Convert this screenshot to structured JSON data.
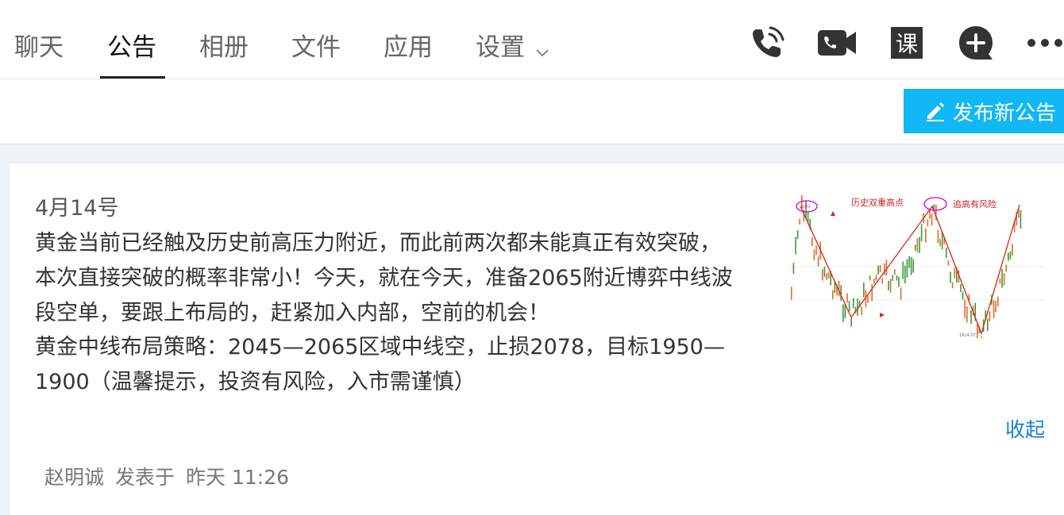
{
  "tabs": [
    {
      "label": "聊天"
    },
    {
      "label": "公告"
    },
    {
      "label": "相册"
    },
    {
      "label": "文件"
    },
    {
      "label": "应用"
    },
    {
      "label": "设置"
    }
  ],
  "active_tab": "公告",
  "toolbar": {
    "publish_label": "发布新公告",
    "icons": [
      "phone-icon",
      "video-call-icon",
      "class-icon",
      "add-icon",
      "more-icon"
    ]
  },
  "announcement": {
    "date": "4月14号",
    "body_lines": [
      "黄金当前已经触及历史前高压力附近，而此前两次都未能真正有效突破，",
      "本次直接突破的概率非常小！今天，就在今天，准备2065附近博弈中线波",
      "段空单，要跟上布局的，赶紧加入内部，空前的机会！",
      "黄金中线布局策略：2045—2065区域中线空，止损2078，目标1950—",
      "1900（温馨提示，投资有风险，入市需谨慎）"
    ],
    "image": {
      "label_left": "历史双重高点",
      "label_right": "追高有风险",
      "low_label": "1614.07",
      "high_label": "2074"
    },
    "collapse_label": "收起",
    "author": "赵明诚",
    "posted_label": "发表于",
    "time": "昨天 11:26"
  },
  "colors": {
    "accent": "#12b7f5",
    "link": "#1a7ed6"
  }
}
